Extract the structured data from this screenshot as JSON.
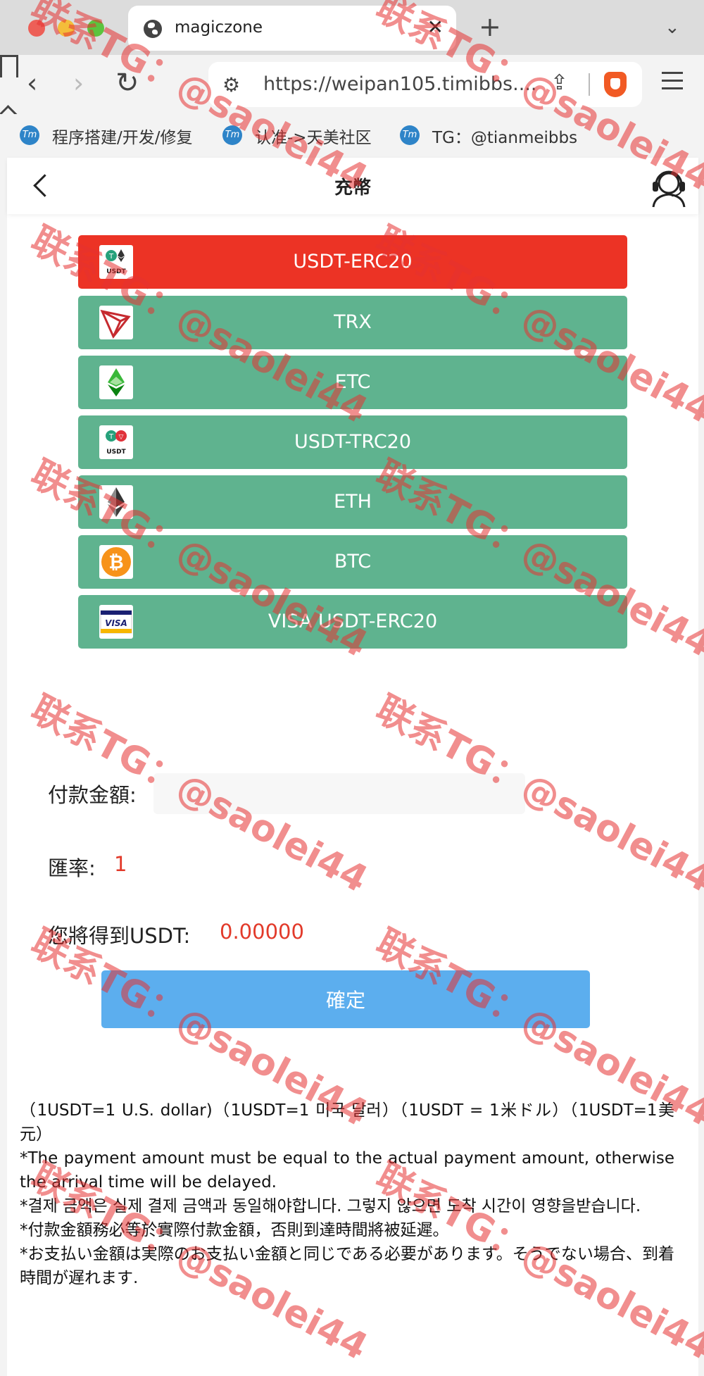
{
  "browser": {
    "tab_title": "magiczone",
    "url": "https://weipan105.timibbs....",
    "bookmarks": [
      {
        "label": "程序搭建/开发/修复"
      },
      {
        "label": "认准->天美社区"
      },
      {
        "label": "TG：@tianmeibbs"
      }
    ],
    "bookmark_icon_text": "Tm"
  },
  "header": {
    "title": "充幣"
  },
  "payment_methods": [
    {
      "label": "USDT-ERC20",
      "icon": "usdt-erc20-icon",
      "selected": true
    },
    {
      "label": "TRX",
      "icon": "trx-icon",
      "selected": false
    },
    {
      "label": "ETC",
      "icon": "etc-icon",
      "selected": false
    },
    {
      "label": "USDT-TRC20",
      "icon": "usdt-trc20-icon",
      "selected": false
    },
    {
      "label": "ETH",
      "icon": "eth-icon",
      "selected": false
    },
    {
      "label": "BTC",
      "icon": "btc-icon",
      "selected": false
    },
    {
      "label": "VISA USDT-ERC20",
      "icon": "visa-icon",
      "selected": false
    }
  ],
  "icon_text": {
    "usdt": "USDT",
    "visa": "VISA"
  },
  "form": {
    "amount_label": "付款金額:",
    "amount_value": "",
    "rate_label": "匯率:",
    "rate_value": "1",
    "receive_label": "您將得到USDT:",
    "receive_value": "0.00000",
    "confirm_label": "確定"
  },
  "notes": [
    "（1USDT=1 U.S. dollar)（1USDT=1 미국 달러）（1USDT = 1米ドル）（1USDT=1美元）",
    "*The payment amount must be equal to the actual payment amount, otherwise the arrival time will be delayed.",
    "*결제 금액은 실제 결제 금액과 동일해야합니다. 그렇지 않으면 도착 시간이 영향을받습니다.",
    "*付款金額務必等於實際付款金額，否則到達時間將被延遲。",
    "*お支払い金額は実際のお支払い金額と同じである必要があります。そうでない場合、到着時間が遅れます."
  ],
  "watermark": "联系TG：@saolei44",
  "colors": {
    "selected": "#ec3325",
    "method": "#5fb38f",
    "confirm": "#5caeee",
    "value_red": "#e23a2a"
  }
}
